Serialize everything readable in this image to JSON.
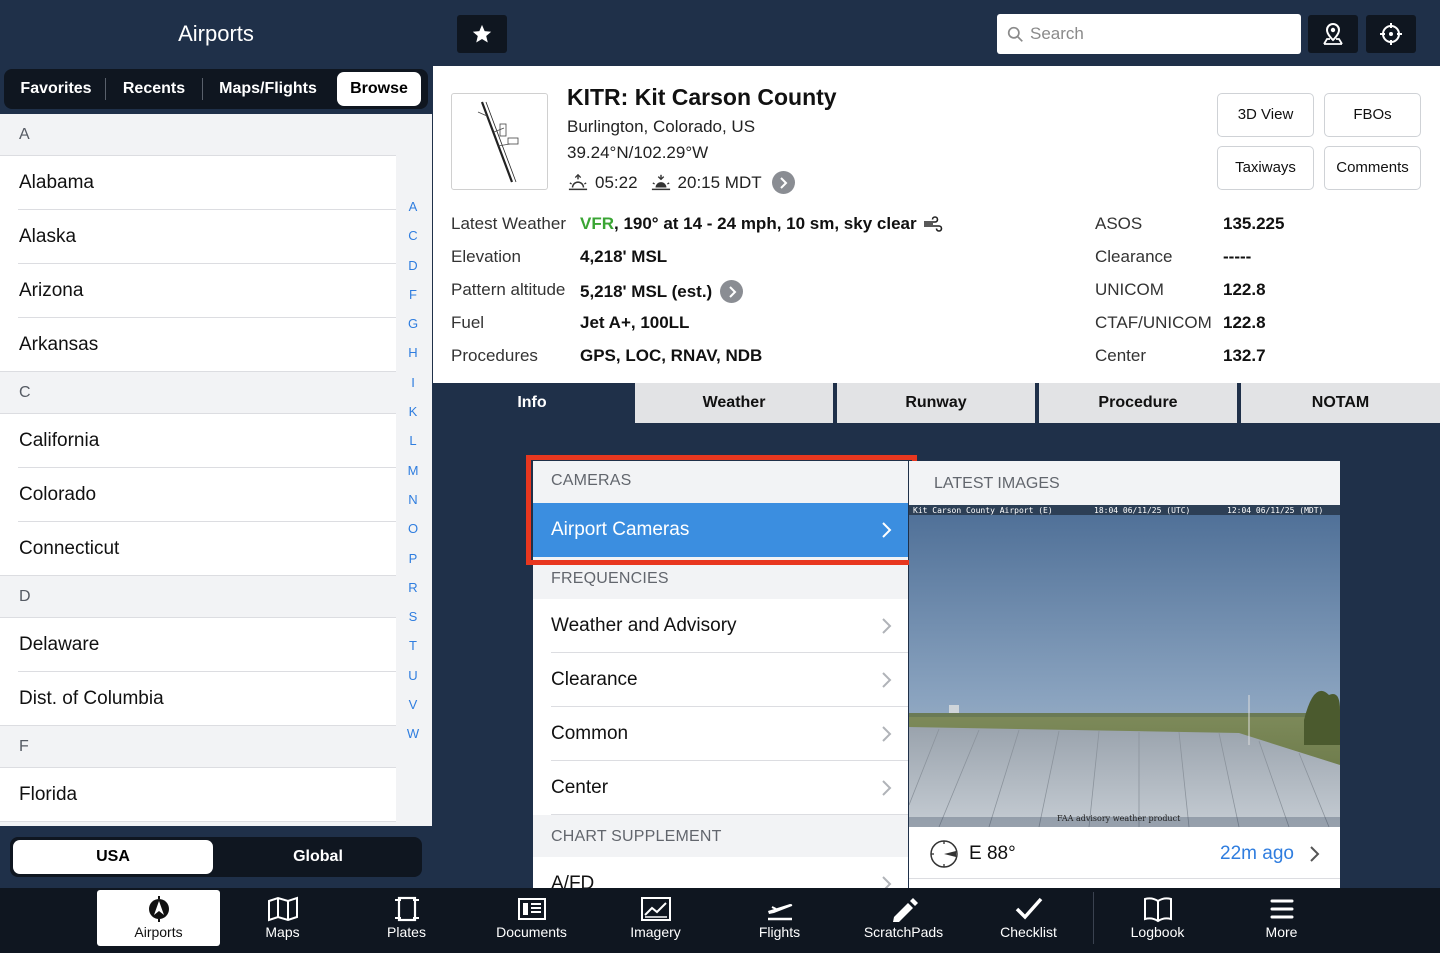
{
  "sidebar": {
    "title": "Airports",
    "segments": [
      "Favorites",
      "Recents",
      "Maps/Flights",
      "Browse"
    ],
    "active_segment": "Browse",
    "sections": [
      {
        "letter": "A",
        "states": [
          "Alabama",
          "Alaska",
          "Arizona",
          "Arkansas"
        ]
      },
      {
        "letter": "C",
        "states": [
          "California",
          "Colorado",
          "Connecticut"
        ]
      },
      {
        "letter": "D",
        "states": [
          "Delaware",
          "Dist. of Columbia"
        ]
      },
      {
        "letter": "F",
        "states": [
          "Florida"
        ]
      }
    ],
    "alpha_index": [
      "A",
      "C",
      "D",
      "F",
      "G",
      "H",
      "I",
      "K",
      "L",
      "M",
      "N",
      "O",
      "P",
      "R",
      "S",
      "T",
      "U",
      "V",
      "W"
    ],
    "region": {
      "usa": "USA",
      "global": "Global",
      "active": "USA"
    }
  },
  "topbar": {
    "search_placeholder": "Search",
    "favorite_icon": "star-icon",
    "location_icon": "map-pin-icon",
    "crosshair_icon": "crosshair-icon"
  },
  "airport": {
    "title": "KITR: Kit Carson County",
    "city": "Burlington, Colorado, US",
    "coords": "39.24°N/102.29°W",
    "sunrise": "05:22",
    "sunset": "20:15 MDT",
    "buttons": {
      "view3d": "3D View",
      "fbos": "FBOs",
      "taxiways": "Taxiways",
      "comments": "Comments"
    },
    "details": {
      "latest_weather_label": "Latest Weather",
      "vfr": "VFR",
      "weather_rest": ", 190° at 14 - 24 mph, 10 sm, sky clear",
      "elevation_label": "Elevation",
      "elevation": "4,218' MSL",
      "pattern_label": "Pattern altitude",
      "pattern": "5,218' MSL (est.)",
      "fuel_label": "Fuel",
      "fuel": "Jet A+, 100LL",
      "procedures_label": "Procedures",
      "procedures": "GPS, LOC, RNAV, NDB"
    },
    "frequencies": [
      {
        "label": "ASOS",
        "value": "135.225"
      },
      {
        "label": "Clearance",
        "value": "-----"
      },
      {
        "label": "UNICOM",
        "value": "122.8"
      },
      {
        "label": "CTAF/UNICOM",
        "value": "122.8"
      },
      {
        "label": "Center",
        "value": "132.7"
      }
    ]
  },
  "tabs": [
    "Info",
    "Weather",
    "Runway",
    "Procedure",
    "NOTAM"
  ],
  "active_tab": "Info",
  "menu": {
    "cameras_head": "CAMERAS",
    "airport_cameras": "Airport Cameras",
    "frequencies_head": "FREQUENCIES",
    "frequency_items": [
      "Weather and Advisory",
      "Clearance",
      "Common",
      "Center"
    ],
    "chart_head": "CHART SUPPLEMENT",
    "chart_items": [
      "A/FD"
    ]
  },
  "images": {
    "head": "LATEST IMAGES",
    "caption_left": "Kit Carson County Airport (E)",
    "caption_mid": "18:04 06/11/25 (UTC)",
    "caption_right": "12:04 06/11/25 (MDT)",
    "watermark": "FAA advisory weather product",
    "direction": "E 88°",
    "age": "22m ago"
  },
  "bottom_nav": [
    {
      "label": "Airports",
      "icon": "airport-compass-icon",
      "active": true
    },
    {
      "label": "Maps",
      "icon": "map-icon"
    },
    {
      "label": "Plates",
      "icon": "plates-icon"
    },
    {
      "label": "Documents",
      "icon": "documents-icon"
    },
    {
      "label": "Imagery",
      "icon": "imagery-icon"
    },
    {
      "label": "Flights",
      "icon": "flights-icon"
    },
    {
      "label": "ScratchPads",
      "icon": "scratchpad-icon"
    },
    {
      "label": "Checklist",
      "icon": "checklist-icon"
    },
    {
      "label": "Logbook",
      "icon": "logbook-icon"
    },
    {
      "label": "More",
      "icon": "more-icon"
    }
  ],
  "colors": {
    "navy": "#1f3049",
    "accent_blue": "#3b8ee0",
    "vfr_green": "#3aa534",
    "highlight_red": "#e8371f"
  }
}
